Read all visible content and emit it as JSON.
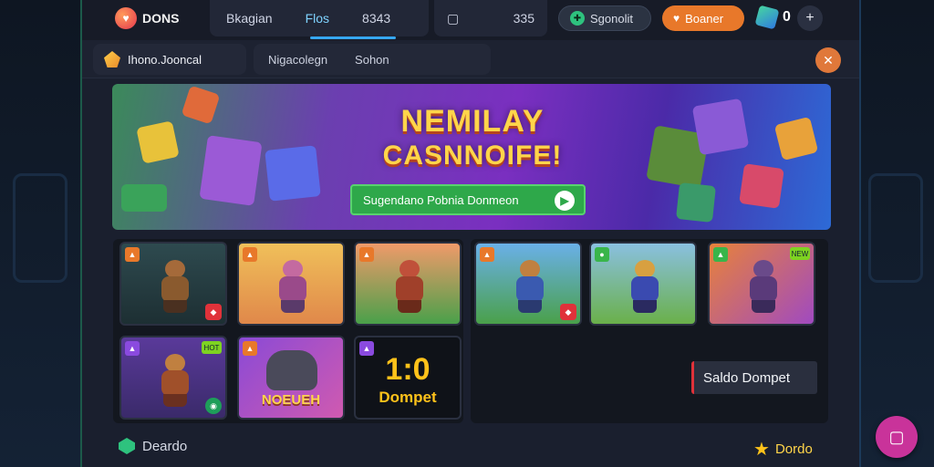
{
  "header": {
    "logo_text": "DONS",
    "nav_group1": [
      "Bkagian",
      "Flos",
      "8343"
    ],
    "nav_group2": [
      "335"
    ],
    "promo_pill": "Sgonolit",
    "bonus_pill": "Boaner",
    "coin_count": "0",
    "plus_label": "+"
  },
  "subnav": {
    "main_tab": "Ihono.Jooncal",
    "tabs": [
      "Nigacolegn",
      "Sohon"
    ]
  },
  "banner": {
    "title_line1": "NEMILAY",
    "title_line2": "CASNNOIFE!",
    "cta_label": "Sugendano Pobnia Donmeon",
    "cta_arrow": "▶"
  },
  "games": {
    "tiles": [
      {
        "badge": "▲",
        "corner": "◆"
      },
      {
        "badge": "▲"
      },
      {
        "badge": "▲"
      },
      {
        "badge": "▲",
        "corner": "◆"
      },
      {
        "badge": "●"
      },
      {
        "badge": "▲",
        "badge2": "NEW"
      },
      {
        "badge": "▲",
        "badge2": "HOT",
        "corner": "◉"
      },
      {
        "badge": "▲",
        "caption": "NOEUEH"
      },
      {
        "badge": "▲",
        "caption_big": "1:0",
        "caption_small": "Dompet"
      }
    ],
    "wallet_label": "Saldo Dompet"
  },
  "footer": {
    "left_label": "Deardo",
    "right_label": "Dordo"
  },
  "colors": {
    "accent_blue": "#36a7f0",
    "accent_orange": "#e8782a",
    "accent_green": "#2ea84a",
    "fab_pink": "#c9339a"
  }
}
